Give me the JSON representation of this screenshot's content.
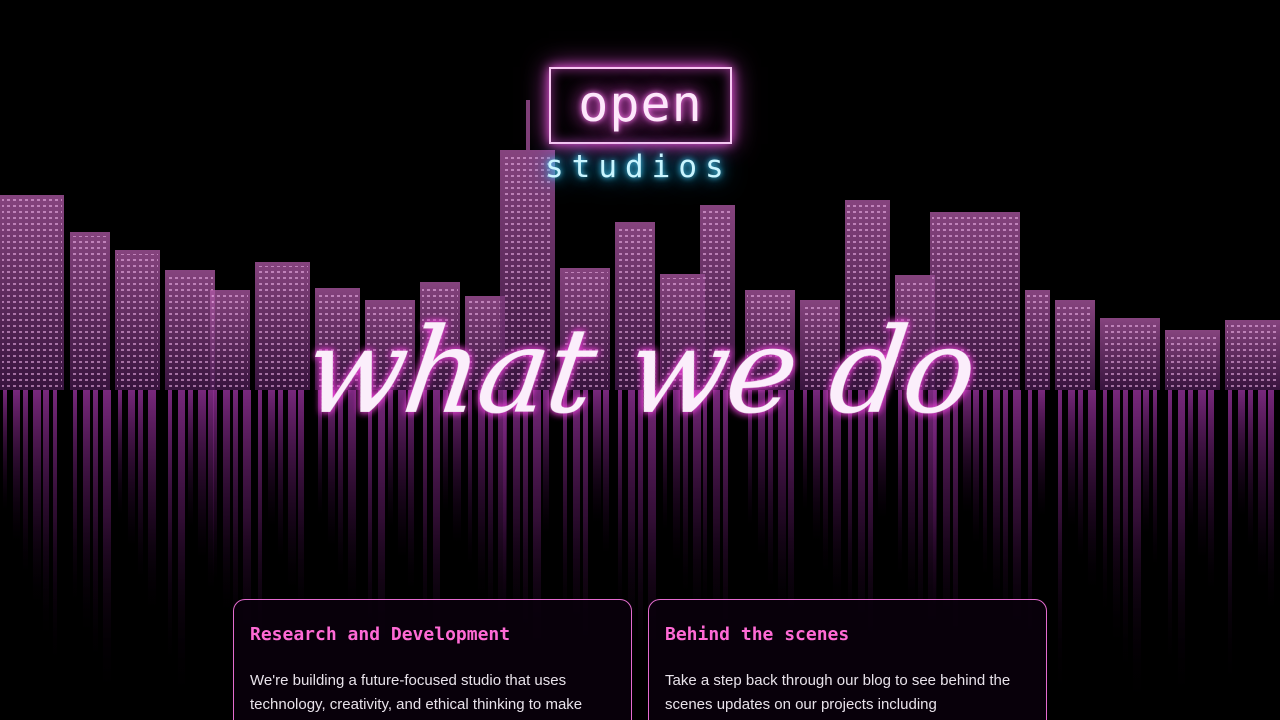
{
  "logo": {
    "primary": "open",
    "secondary": "studios"
  },
  "hero": {
    "headline": "what we do"
  },
  "cards": [
    {
      "title": "Research and Development",
      "body": "We're building a future-focused studio that uses technology, creativity, and ethical thinking to make"
    },
    {
      "title": "Behind the scenes",
      "body": "Take a step back through our blog to see behind the scenes updates on our projects including retrospectives"
    }
  ],
  "colors": {
    "background": "#000000",
    "neon_pink": "#ff6ad5",
    "neon_cyan": "#4fd6ff",
    "card_border": "#e46ccf"
  },
  "background_image": "neon-city-skyline-reflection"
}
